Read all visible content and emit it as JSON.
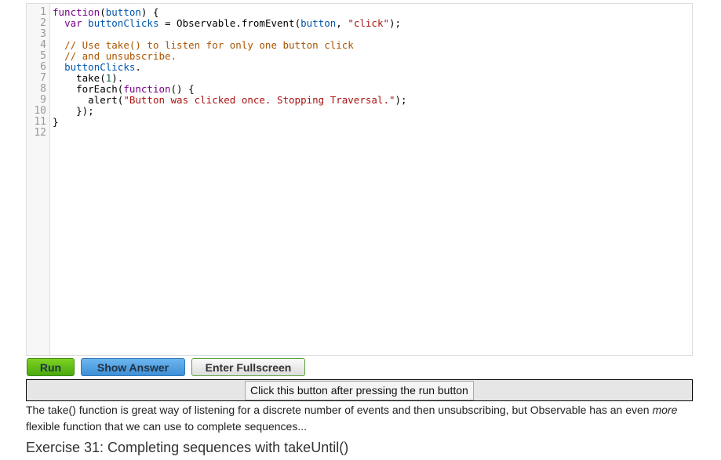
{
  "editor": {
    "line_numbers": [
      "1",
      "2",
      "3",
      "4",
      "5",
      "6",
      "7",
      "8",
      "9",
      "10",
      "11",
      "12"
    ],
    "lines": [
      [
        [
          "kw",
          "function"
        ],
        [
          "",
          "("
        ],
        [
          "var",
          "button"
        ],
        [
          "",
          ") {"
        ]
      ],
      [
        [
          "",
          "  "
        ],
        [
          "kw",
          "var"
        ],
        [
          "",
          " "
        ],
        [
          "var",
          "buttonClicks"
        ],
        [
          "",
          " = Observable.fromEvent("
        ],
        [
          "var",
          "button"
        ],
        [
          "",
          ", "
        ],
        [
          "str",
          "\"click\""
        ],
        [
          "",
          ");"
        ]
      ],
      [],
      [
        [
          "",
          "  "
        ],
        [
          "cm",
          "// Use take() to listen for only one button click"
        ]
      ],
      [
        [
          "",
          "  "
        ],
        [
          "cm",
          "// and unsubscribe."
        ]
      ],
      [
        [
          "",
          "  "
        ],
        [
          "var",
          "buttonClicks"
        ],
        [
          "",
          "."
        ]
      ],
      [
        [
          "",
          "    take("
        ],
        [
          "num",
          "1"
        ],
        [
          "",
          ")."
        ]
      ],
      [
        [
          "",
          "    forEach("
        ],
        [
          "kw",
          "function"
        ],
        [
          "",
          "() {"
        ]
      ],
      [
        [
          "",
          "      alert("
        ],
        [
          "str",
          "\"Button was clicked once. Stopping Traversal.\""
        ],
        [
          "",
          ");"
        ]
      ],
      [
        [
          "",
          "    });"
        ]
      ],
      [
        [
          "",
          "}"
        ]
      ],
      []
    ]
  },
  "buttons": {
    "run": "Run",
    "show_answer": "Show Answer",
    "fullscreen": "Enter Fullscreen"
  },
  "panel": {
    "click_button": "Click this button after pressing the run button"
  },
  "paragraph": {
    "before": "The take() function is great way of listening for a discrete number of events and then unsubscribing, but Observable has an even ",
    "em": "more",
    "after": " flexible function that we can use to complete sequences..."
  },
  "heading": "Exercise 31: Completing sequences with takeUntil()"
}
